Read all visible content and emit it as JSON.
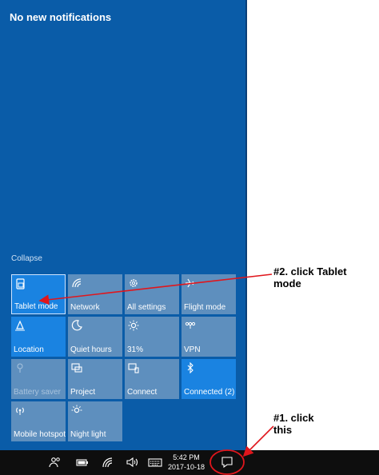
{
  "notifications": {
    "header": "No new notifications"
  },
  "action_center": {
    "collapse_label": "Collapse",
    "tiles": [
      {
        "label": "Tablet mode",
        "icon": "tablet-mode-icon",
        "state": "on"
      },
      {
        "label": "Network",
        "icon": "network-icon",
        "state": "off"
      },
      {
        "label": "All settings",
        "icon": "gear-icon",
        "state": "off"
      },
      {
        "label": "Flight mode",
        "icon": "airplane-icon",
        "state": "off"
      },
      {
        "label": "Location",
        "icon": "location-icon",
        "state": "on"
      },
      {
        "label": "Quiet hours",
        "icon": "moon-icon",
        "state": "off"
      },
      {
        "label": "31%",
        "icon": "brightness-icon",
        "state": "off"
      },
      {
        "label": "VPN",
        "icon": "vpn-icon",
        "state": "off"
      },
      {
        "label": "Battery saver",
        "icon": "battery-saver-icon",
        "state": "disabled"
      },
      {
        "label": "Project",
        "icon": "project-icon",
        "state": "off"
      },
      {
        "label": "Connect",
        "icon": "connect-icon",
        "state": "off"
      },
      {
        "label": "Connected (2)",
        "icon": "bluetooth-icon",
        "state": "on"
      },
      {
        "label": "Mobile hotspot",
        "icon": "hotspot-icon",
        "state": "off"
      },
      {
        "label": "Night light",
        "icon": "night-light-icon",
        "state": "off"
      }
    ]
  },
  "taskbar": {
    "time": "5:42 PM",
    "date": "2017-10-18"
  },
  "annotations": {
    "step2_line1": "#2. click Tablet",
    "step2_line2": "mode",
    "step1_line1": "#1. click",
    "step1_line2": "this"
  },
  "colors": {
    "panel": "#0a5ca8",
    "tile_on": "#1a83e1",
    "tile_off": "#5e8fbe",
    "taskbar": "#0e0e0e",
    "annotation": "#e0161c"
  }
}
